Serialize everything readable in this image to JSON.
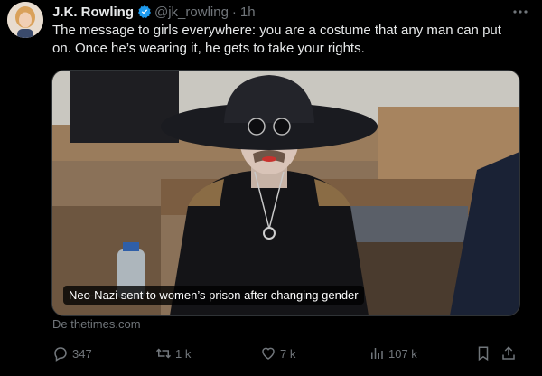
{
  "tweet": {
    "author_name": "J.K. Rowling",
    "handle": "@jk_rowling",
    "separator": "·",
    "time": "1h",
    "text": "The message to girls everywhere: you are a costume that any man can put on. Once he’s wearing it, he gets to take your rights.",
    "media": {
      "caption": "Neo-Nazi sent to women’s prison after changing gender"
    },
    "source": "De thetimes.com"
  },
  "actions": {
    "replies": "347",
    "reposts": "1 k",
    "likes": "7 k",
    "views": "107 k"
  },
  "icons": [
    "verified-badge-icon",
    "more-icon",
    "reply-icon",
    "repost-icon",
    "like-icon",
    "views-icon",
    "bookmark-icon",
    "share-icon"
  ],
  "colors": {
    "background": "#000000",
    "text": "#e7e9ea",
    "secondary": "#71767b",
    "verified": "#1d9bf0"
  }
}
